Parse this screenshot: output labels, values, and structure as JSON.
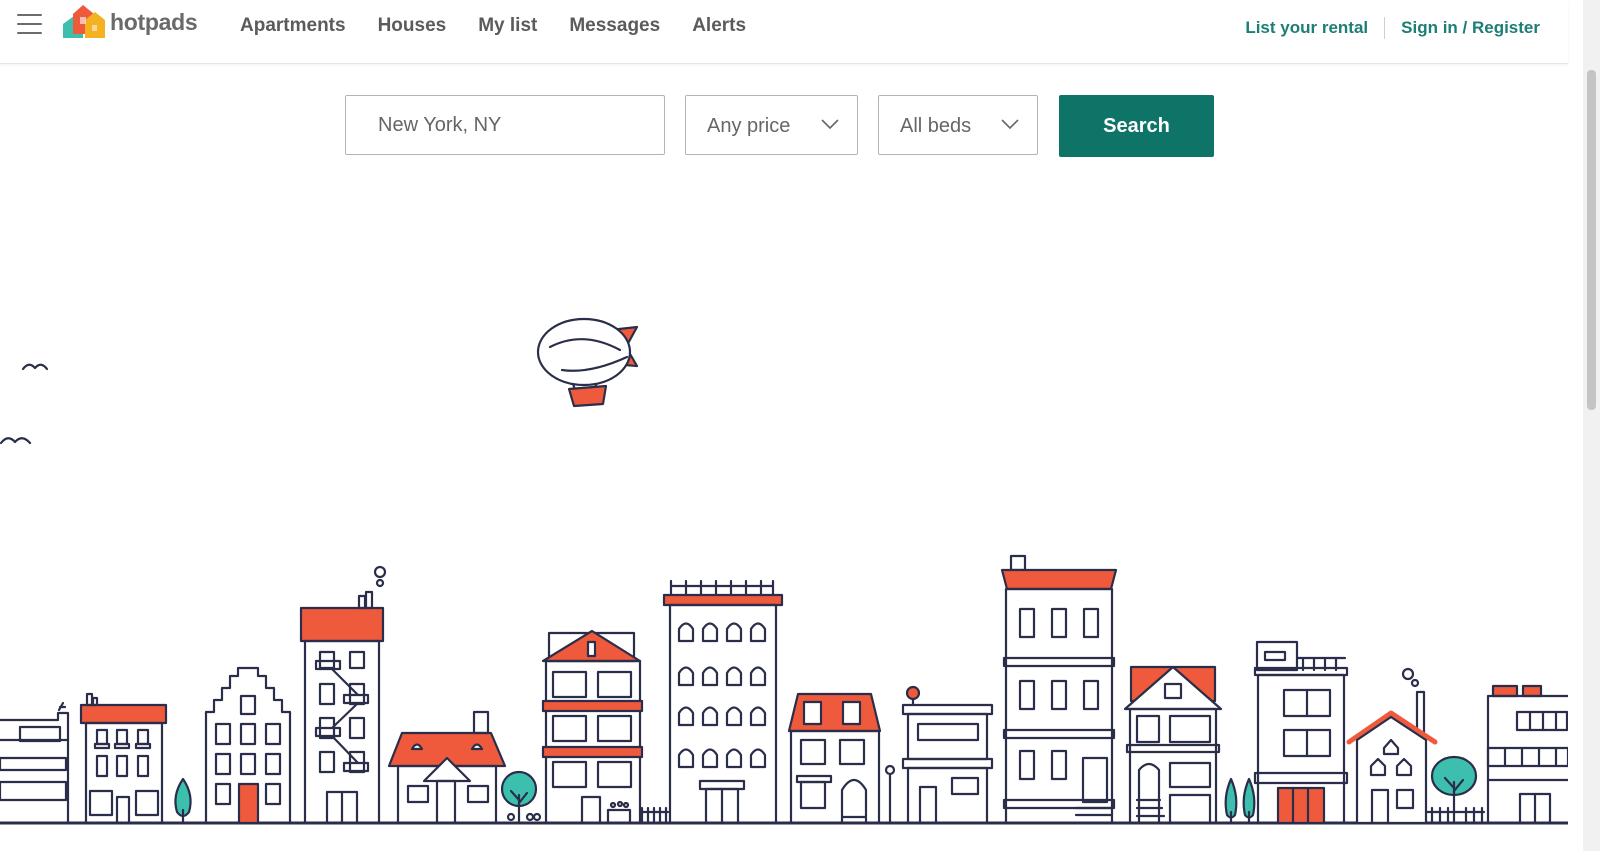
{
  "header": {
    "logo_text": "hotpads",
    "nav": [
      "Apartments",
      "Houses",
      "My list",
      "Messages",
      "Alerts"
    ],
    "list_rental": "List your rental",
    "sign_in": "Sign in / Register"
  },
  "search": {
    "location_value": "New York, NY",
    "price_label": "Any price",
    "beds_label": "All beds",
    "button_label": "Search"
  },
  "colors": {
    "accent": "#0f7468",
    "link": "#1c7e75",
    "roof_orange": "#ef5a3c",
    "outline_navy": "#2a2e4a",
    "tree_teal": "#3dbfae"
  },
  "icons": {
    "menu": "hamburger-icon",
    "dropdown": "chevron-down-icon",
    "blimp": "blimp-illustration"
  }
}
